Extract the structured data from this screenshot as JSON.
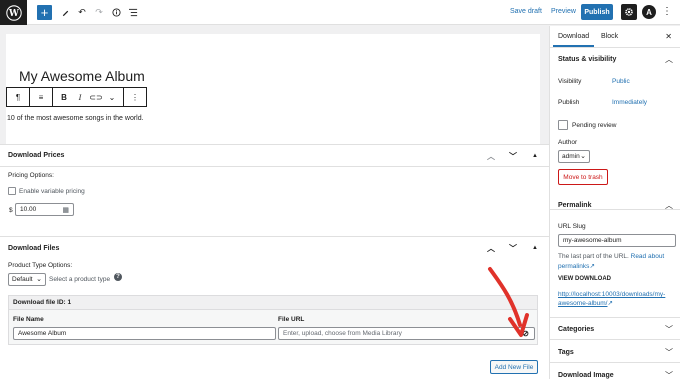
{
  "topbar": {
    "save_draft": "Save draft",
    "preview": "Preview",
    "publish": "Publish",
    "a_letter": "A"
  },
  "editor": {
    "title": "My Awesome Album",
    "excerpt": "10 of the most awesome songs in the world."
  },
  "download_prices": {
    "heading": "Download Prices",
    "pricing_options": "Pricing Options:",
    "variable_pricing_label": "Enable variable pricing",
    "currency": "$",
    "price": "10.00"
  },
  "download_files": {
    "heading": "Download Files",
    "product_type_label": "Product Type Options:",
    "product_type_value": "Default",
    "product_type_hint": "Select a product type",
    "help": "?",
    "file_id_label": "Download file ID: 1",
    "file_name_label": "File Name",
    "file_name_value": "Awesome Album",
    "file_url_label": "File URL",
    "file_url_placeholder": "Enter, upload, choose from Media Library",
    "add_new_file": "Add New File"
  },
  "sidebar": {
    "tab_download": "Download",
    "tab_block": "Block",
    "status_heading": "Status & visibility",
    "visibility_label": "Visibility",
    "visibility_value": "Public",
    "publish_label": "Publish",
    "publish_value": "Immediately",
    "pending_review": "Pending review",
    "author_label": "Author",
    "author_value": "admin",
    "move_to_trash": "Move to trash",
    "permalink_heading": "Permalink",
    "url_slug_label": "URL Slug",
    "url_slug_value": "my-awesome-album",
    "permalink_note": "The last part of the URL. ",
    "read_about": "Read about",
    "permalinks": "permalinks",
    "view_download": "VIEW DOWNLOAD",
    "view_url_1": "http://localhost:10003/downloads/my-",
    "view_url_2": "awesome-album/",
    "categories": "Categories",
    "tags": "Tags",
    "download_image": "Download Image"
  },
  "colors": {
    "accent": "#2271b1",
    "arrow": "#e0322a",
    "danger": "#cc1818"
  }
}
